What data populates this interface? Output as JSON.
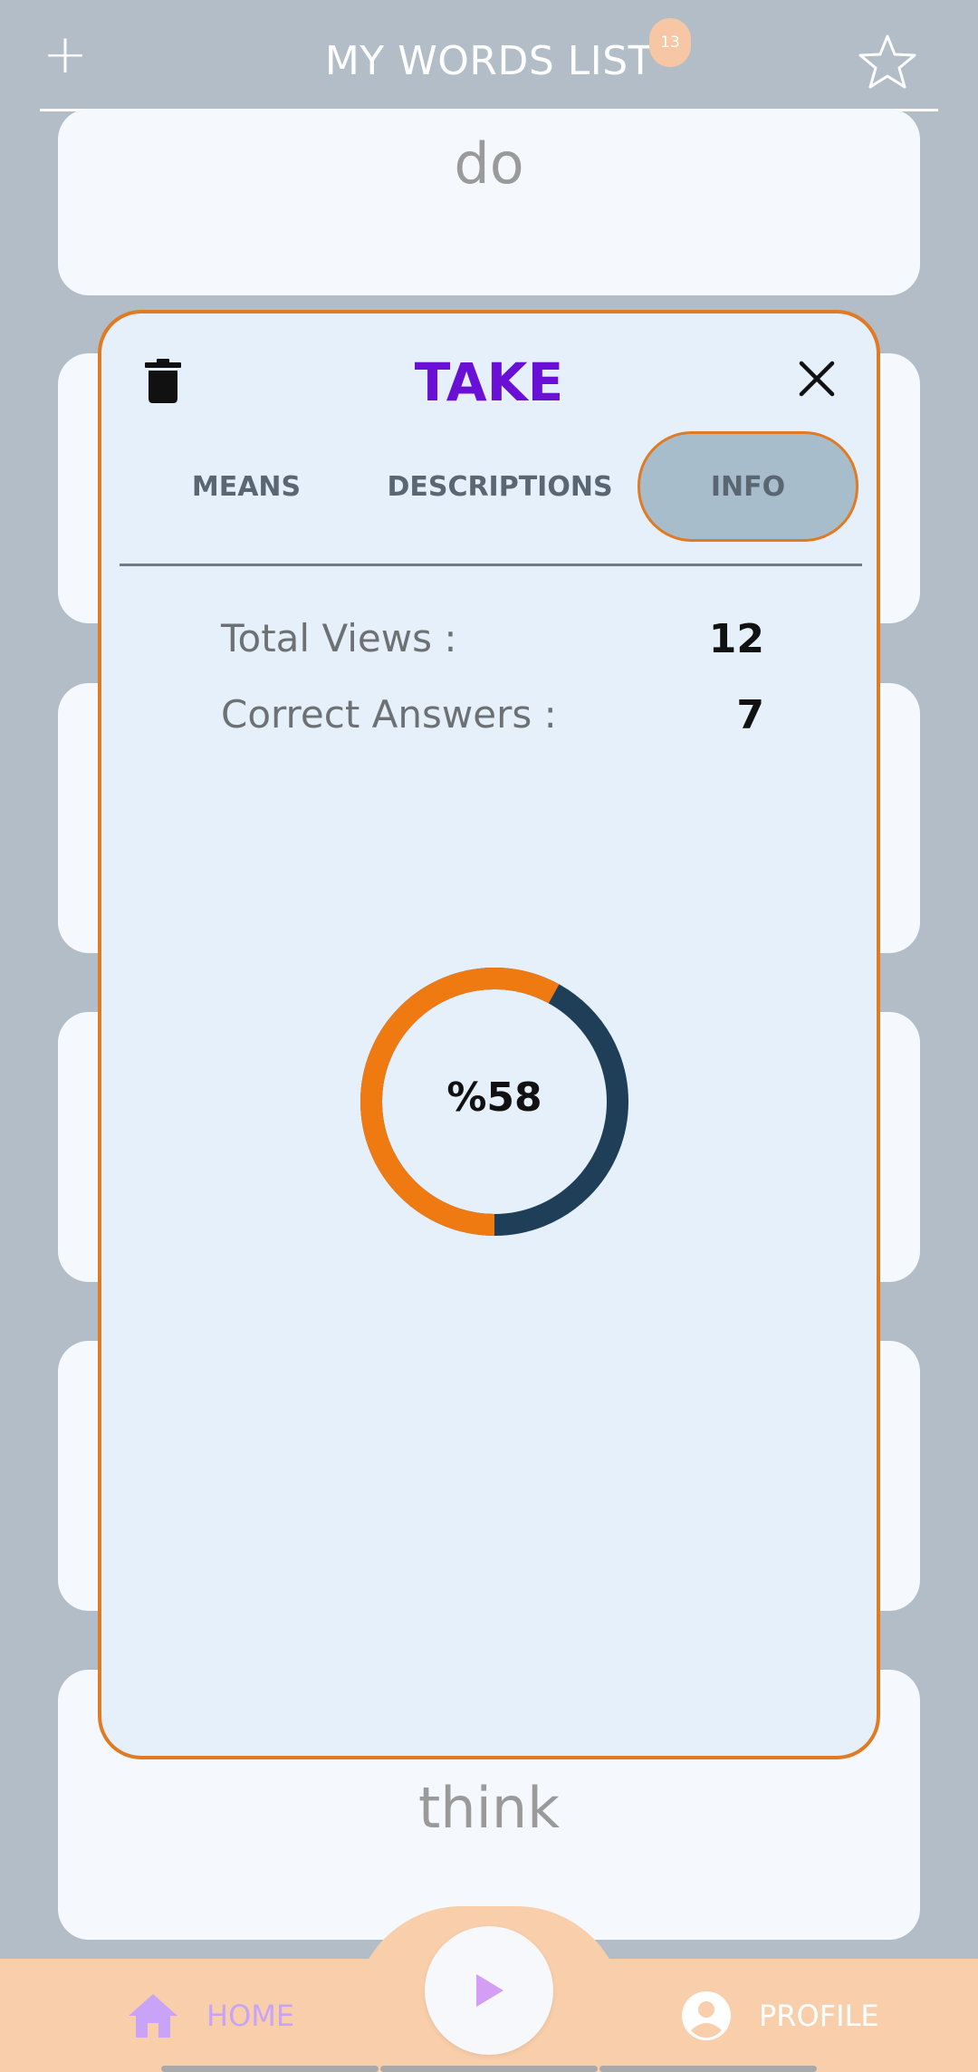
{
  "header": {
    "title": "MY WORDS LIST",
    "count": "13",
    "add_icon": "plus-icon",
    "favorite_icon": "star-outline-icon"
  },
  "cards": [
    {
      "word": "do"
    },
    {
      "word": "think"
    }
  ],
  "popup": {
    "word": "TAKE",
    "tabs": [
      {
        "label": "MEANS",
        "active": false
      },
      {
        "label": "DESCRIPTIONS",
        "active": false
      },
      {
        "label": "INFO",
        "active": true
      }
    ],
    "stats": {
      "total_views_label": "Total Views :",
      "total_views_value": "12",
      "correct_answers_label": "Correct Answers :",
      "correct_answers_value": "7"
    },
    "progress": {
      "label": "%58",
      "fraction": 0.58,
      "colors": {
        "progress": "#f07a12",
        "remaining": "#1f3f59"
      }
    }
  },
  "nav": {
    "home_label": "HOME",
    "profile_label": "PROFILE",
    "play_icon": "play-icon"
  },
  "colors": {
    "accent_orange": "#e07b23",
    "title_purple": "#6a0fd6",
    "nav_background": "#f9cfab",
    "app_background": "#b2bdc7"
  }
}
